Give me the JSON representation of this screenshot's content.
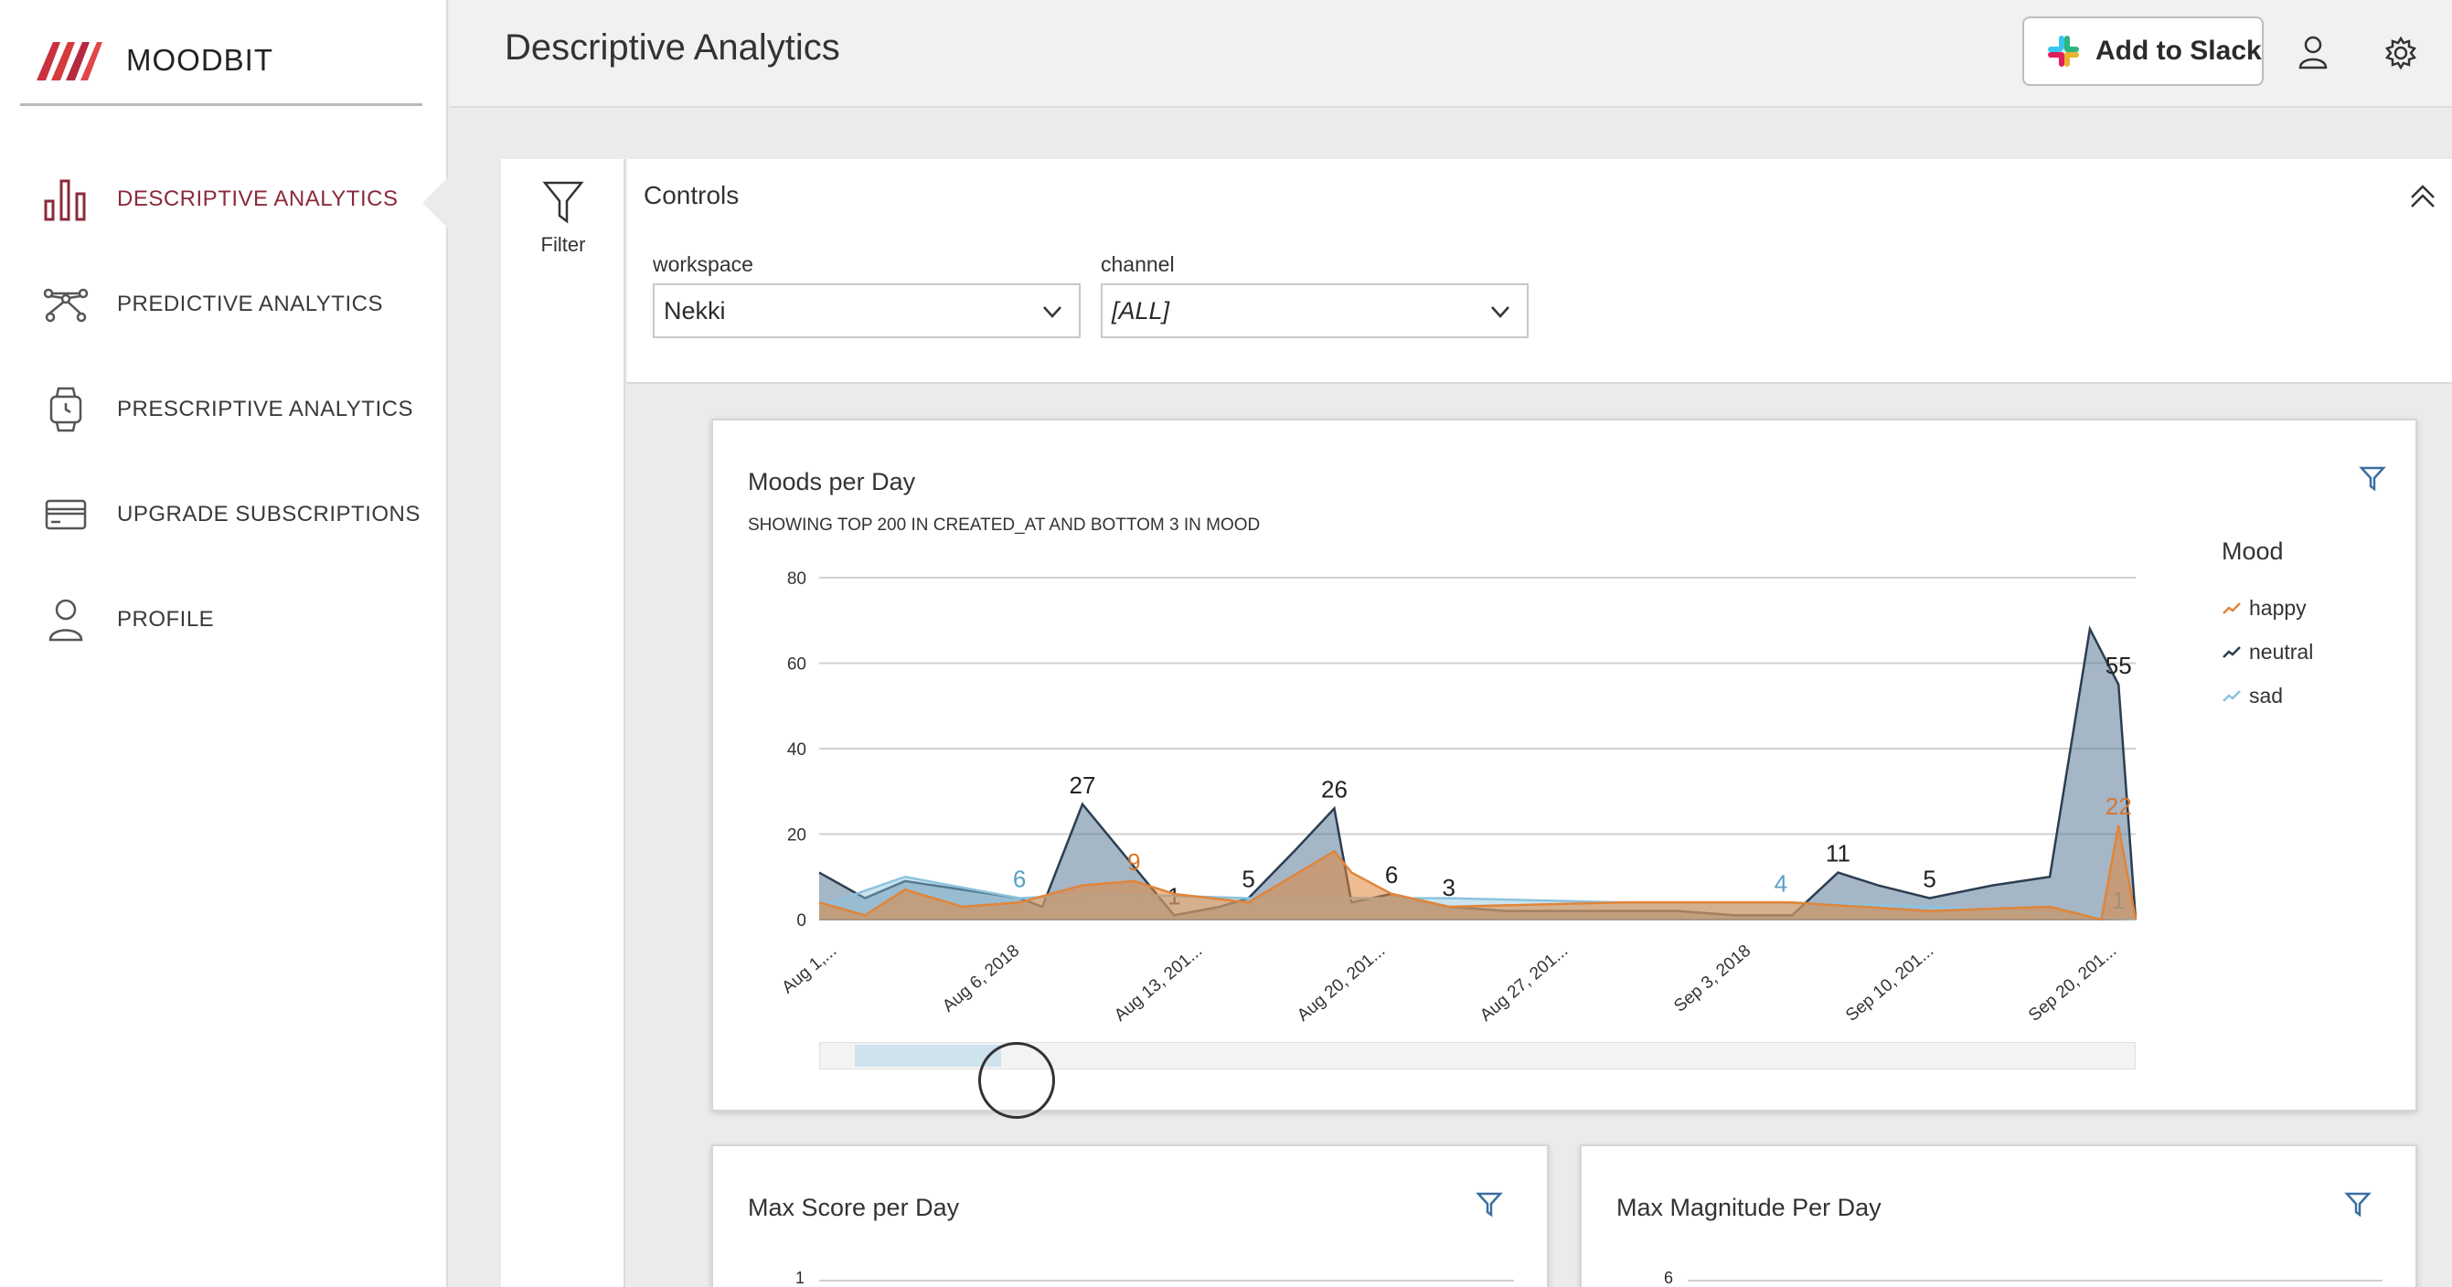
{
  "app": {
    "name": "MOODBIT",
    "page_title": "Descriptive Analytics"
  },
  "sidebar": {
    "items": [
      {
        "label": "DESCRIPTIVE ANALYTICS",
        "icon": "bar-chart-icon",
        "active": true
      },
      {
        "label": "PREDICTIVE ANALYTICS",
        "icon": "network-icon"
      },
      {
        "label": "PRESCRIPTIVE ANALYTICS",
        "icon": "watch-icon"
      },
      {
        "label": "UPGRADE SUBSCRIPTIONS",
        "icon": "credit-card-icon"
      },
      {
        "label": "PROFILE",
        "icon": "user-icon"
      }
    ]
  },
  "header": {
    "slack_button": "Add to Slack",
    "icons": [
      "user-icon",
      "gear-icon"
    ]
  },
  "filter": {
    "label": "Filter"
  },
  "controls": {
    "title": "Controls",
    "workspace_label": "workspace",
    "workspace_value": "Nekki",
    "channel_label": "channel",
    "channel_value": "[ALL]"
  },
  "moods_card": {
    "title": "Moods per Day",
    "subtitle": "SHOWING TOP 200 IN CREATED_AT AND BOTTOM 3 IN MOOD",
    "legend_title": "Mood",
    "legend": [
      "happy",
      "neutral",
      "sad"
    ]
  },
  "max_score_card": {
    "title": "Max Score per Day",
    "first_tick": "1"
  },
  "max_magnitude_card": {
    "title": "Max Magnitude Per Day",
    "first_tick": "6"
  },
  "colors": {
    "happy": "#e0853a",
    "neutral": "#2c3e50",
    "sad": "#8cc3de",
    "accent": "#8a2a3a"
  },
  "chart_data": {
    "type": "area",
    "x_tick_labels": [
      "Aug 1,...",
      "Aug 6, 2018",
      "Aug 13, 201...",
      "Aug 20, 201...",
      "Aug 27, 201...",
      "Sep 3, 2018",
      "Sep 10, 201...",
      "Sep 20, 201..."
    ],
    "ylim": [
      0,
      80
    ],
    "y_ticks": [
      0,
      20,
      40,
      60,
      80
    ],
    "grid": true,
    "legend_position": "right",
    "series": [
      {
        "name": "neutral",
        "x": [
          0,
          0.8,
          1.5,
          2.5,
          3.5,
          3.9,
          4.6,
          6.2,
          7,
          7.5,
          8.3,
          9,
          9.3,
          10,
          11,
          12,
          13,
          14,
          15,
          16,
          17,
          17.8,
          18.5,
          19.4,
          20.5,
          21.5,
          22.2,
          22.7,
          23
        ],
        "values": [
          11,
          5,
          9,
          7,
          5,
          3,
          27,
          1,
          3,
          5,
          16,
          26,
          4,
          6,
          3,
          2,
          2,
          2,
          2,
          1,
          1,
          11,
          8,
          5,
          8,
          10,
          68,
          55,
          0
        ],
        "labels": [
          {
            "x": 4.6,
            "text": "27"
          },
          {
            "x": 6.2,
            "text": "1"
          },
          {
            "x": 7.5,
            "text": "5"
          },
          {
            "x": 9,
            "text": "26"
          },
          {
            "x": 10,
            "text": "6"
          },
          {
            "x": 11,
            "text": "3"
          },
          {
            "x": 17.8,
            "text": "11"
          },
          {
            "x": 19.4,
            "text": "5"
          },
          {
            "x": 22.7,
            "text": "55"
          }
        ]
      },
      {
        "name": "happy",
        "x": [
          0,
          0.8,
          1.5,
          2.5,
          3.5,
          4.6,
          5.5,
          6.2,
          7.5,
          9,
          9.3,
          10,
          11,
          14,
          17,
          19.4,
          21.5,
          22.4,
          22.7,
          23
        ],
        "values": [
          4,
          1,
          7,
          3,
          4,
          8,
          9,
          6,
          4,
          16,
          11,
          6,
          3,
          4,
          4,
          2,
          3,
          0,
          22,
          0
        ],
        "labels": [
          {
            "x": 5.5,
            "text": "9"
          },
          {
            "x": 22.7,
            "text": "22"
          }
        ]
      },
      {
        "name": "sad",
        "x": [
          0,
          1.5,
          3.5,
          5,
          7.5,
          9,
          11,
          14,
          16.8,
          19.4,
          22,
          23
        ],
        "values": [
          3,
          10,
          5,
          6,
          5,
          5,
          5,
          4,
          4,
          3,
          1,
          0
        ],
        "labels": [
          {
            "x": 3.5,
            "text": "6"
          },
          {
            "x": 16.8,
            "text": "4"
          },
          {
            "x": 22.7,
            "text": "1"
          }
        ]
      }
    ]
  }
}
